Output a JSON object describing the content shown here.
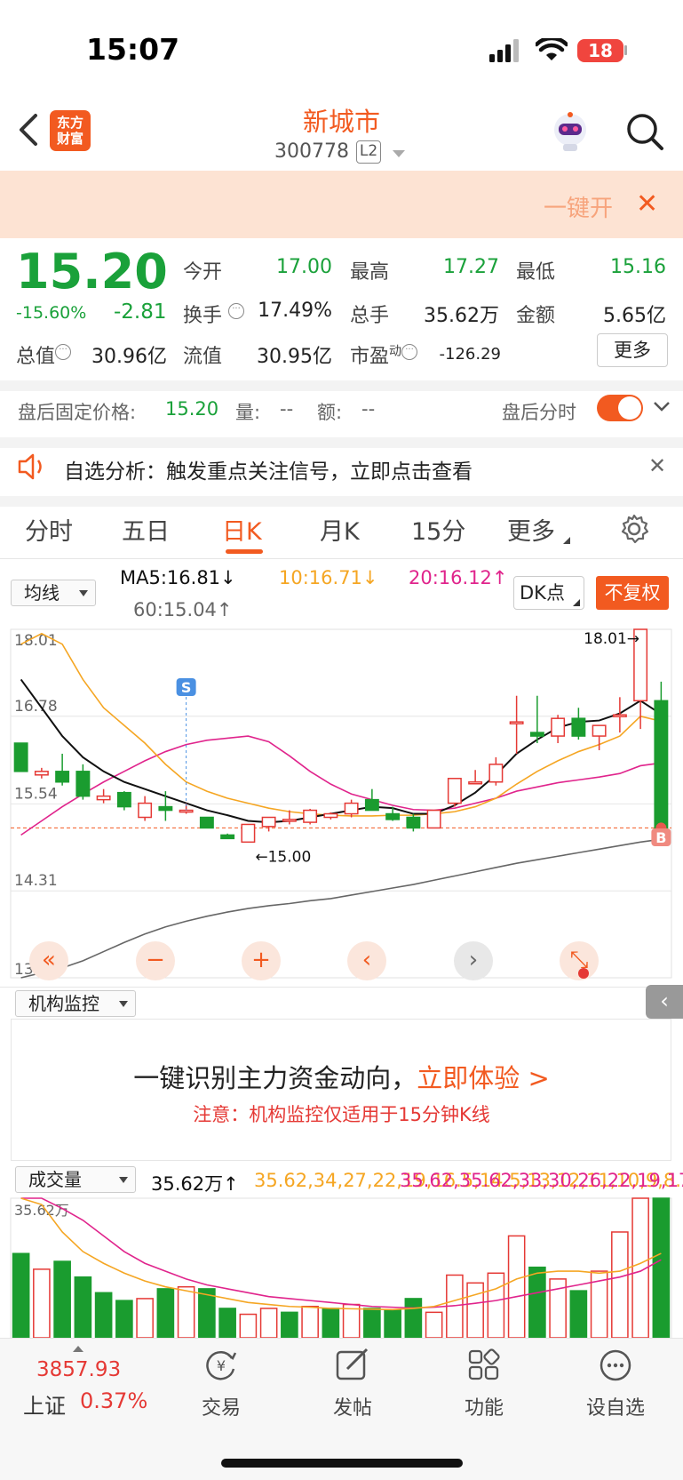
{
  "status_bar": {
    "time": "15:07",
    "battery": "18"
  },
  "header": {
    "logo_line1": "东方",
    "logo_line2": "财富",
    "name": "新城市",
    "code": "300778",
    "level": "L2"
  },
  "banner": {
    "text": "一键开",
    "close": "✕"
  },
  "quote": {
    "price": "15.20",
    "pct": "-15.60%",
    "change": "-2.81",
    "fields": {
      "open_label": "今开",
      "open": "17.00",
      "high_label": "最高",
      "high": "17.27",
      "low_label": "最低",
      "low": "15.16",
      "turnover_label": "换手",
      "turnover": "17.49%",
      "total_hands_label": "总手",
      "total_hands": "35.62万",
      "amount_label": "金额",
      "amount": "5.65亿",
      "mcap_label": "总值",
      "mcap": "30.96亿",
      "float_label": "流值",
      "float": "30.95亿",
      "pe_label": "市盈",
      "pe_sup": "动",
      "pe": "-126.29"
    },
    "more": "更多"
  },
  "after_hours": {
    "label": "盘后固定价格:",
    "price": "15.20",
    "vol_label": "量:",
    "vol": "--",
    "amt_label": "额:",
    "amt": "--",
    "toggle_label": "盘后分时"
  },
  "alert": {
    "text": "自选分析：触发重点关注信号，立即点击查看",
    "close": "✕"
  },
  "tabs": [
    "分时",
    "五日",
    "日K",
    "月K",
    "15分",
    "更多"
  ],
  "active_tab": "日K",
  "ma_bar": {
    "selector": "均线",
    "ma5": "MA5:16.81↓",
    "ma10": "10:16.71↓",
    "ma20": "20:16.12↑",
    "ma60": "60:15.04↑",
    "dk": "DK点",
    "fq": "不复权"
  },
  "colors": {
    "up": "#e53935",
    "down": "#1a9c2f",
    "accent": "#f25a20",
    "ma5": "#111111",
    "ma10": "#f5a623",
    "ma20": "#e0248c",
    "ma60": "#666666"
  },
  "chart_data": {
    "type": "candlestick",
    "y_ticks": [
      "18.01",
      "16.78",
      "15.54",
      "14.31",
      "13.08"
    ],
    "ylim": [
      13.08,
      18.01
    ],
    "markers": {
      "high_label": "18.01",
      "low_label": "15.00",
      "sell": "S",
      "buy": "B"
    },
    "candles": [
      [
        16.4,
        16.4,
        16.0,
        16.0
      ],
      [
        15.95,
        16.05,
        15.9,
        16.0
      ],
      [
        16.0,
        16.25,
        15.8,
        15.85
      ],
      [
        16.0,
        16.1,
        15.6,
        15.65
      ],
      [
        15.6,
        15.75,
        15.55,
        15.65
      ],
      [
        15.7,
        15.72,
        15.45,
        15.5
      ],
      [
        15.35,
        15.65,
        15.3,
        15.55
      ],
      [
        15.5,
        15.72,
        15.3,
        15.45
      ],
      [
        15.45,
        15.55,
        15.4,
        15.45
      ],
      [
        15.35,
        15.35,
        15.2,
        15.2
      ],
      [
        15.1,
        15.12,
        15.05,
        15.05
      ],
      [
        15.0,
        15.25,
        15.0,
        15.25
      ],
      [
        15.22,
        15.35,
        15.15,
        15.35
      ],
      [
        15.3,
        15.45,
        15.25,
        15.32
      ],
      [
        15.28,
        15.47,
        15.25,
        15.45
      ],
      [
        15.35,
        15.42,
        15.32,
        15.4
      ],
      [
        15.4,
        15.6,
        15.35,
        15.55
      ],
      [
        15.6,
        15.75,
        15.45,
        15.45
      ],
      [
        15.4,
        15.5,
        15.3,
        15.32
      ],
      [
        15.35,
        15.4,
        15.15,
        15.2
      ],
      [
        15.2,
        15.45,
        15.2,
        15.45
      ],
      [
        15.55,
        15.9,
        15.5,
        15.9
      ],
      [
        15.85,
        16.02,
        15.83,
        15.85
      ],
      [
        15.85,
        16.2,
        15.8,
        16.1
      ],
      [
        16.7,
        17.07,
        16.25,
        16.7
      ],
      [
        16.55,
        17.07,
        16.4,
        16.5
      ],
      [
        16.5,
        16.8,
        16.4,
        16.75
      ],
      [
        16.75,
        16.9,
        16.45,
        16.5
      ],
      [
        16.5,
        16.6,
        16.3,
        16.65
      ],
      [
        16.8,
        17.05,
        16.55,
        16.8
      ],
      [
        17.0,
        18.01,
        16.6,
        18.01
      ],
      [
        17.0,
        17.27,
        15.16,
        15.2
      ]
    ],
    "ma5": [
      17.3,
      16.9,
      16.5,
      16.2,
      16.0,
      15.85,
      15.75,
      15.65,
      15.55,
      15.45,
      15.38,
      15.3,
      15.28,
      15.3,
      15.35,
      15.4,
      15.45,
      15.5,
      15.48,
      15.4,
      15.4,
      15.52,
      15.7,
      15.95,
      16.25,
      16.45,
      16.62,
      16.7,
      16.72,
      16.82,
      17.0,
      16.81
    ],
    "ma10": [
      17.8,
      17.95,
      17.8,
      17.3,
      16.9,
      16.65,
      16.4,
      16.1,
      15.85,
      15.72,
      15.62,
      15.55,
      15.48,
      15.43,
      15.4,
      15.38,
      15.37,
      15.37,
      15.38,
      15.38,
      15.4,
      15.43,
      15.5,
      15.62,
      15.82,
      16.0,
      16.15,
      16.28,
      16.38,
      16.5,
      16.78,
      16.71
    ],
    "ma20": [
      15.1,
      15.3,
      15.5,
      15.68,
      15.85,
      16.0,
      16.15,
      16.28,
      16.38,
      16.44,
      16.47,
      16.5,
      16.42,
      16.22,
      16.0,
      15.82,
      15.68,
      15.6,
      15.52,
      15.46,
      15.45,
      15.48,
      15.55,
      15.62,
      15.72,
      15.78,
      15.84,
      15.88,
      15.92,
      15.97,
      16.08,
      16.12
    ],
    "ma60": [
      13.08,
      13.15,
      13.22,
      13.32,
      13.45,
      13.58,
      13.7,
      13.8,
      13.88,
      13.95,
      14.01,
      14.06,
      14.1,
      14.13,
      14.17,
      14.2,
      14.25,
      14.3,
      14.35,
      14.4,
      14.46,
      14.52,
      14.58,
      14.64,
      14.7,
      14.75,
      14.8,
      14.85,
      14.9,
      14.95,
      15.0,
      15.04
    ]
  },
  "chart_nav": [
    "«",
    "−",
    "+",
    "‹",
    "›",
    "⤡"
  ],
  "institution": {
    "selector": "机构监控",
    "headline": "一键识别主力资金动向，",
    "cta": "立即体验 >",
    "note": "注意：机构监控仅适用于15分钟K线",
    "side": "‹"
  },
  "volume": {
    "selector": "成交量",
    "vol": "35.62万↑",
    "ma1": [
      35.62,
      34.0,
      27.0,
      22.0,
      19.0,
      16.5,
      14.5,
      13.0,
      12.0,
      11.0,
      10.0,
      9.0,
      8.5,
      8.0,
      7.8,
      7.5,
      7.4,
      7.3,
      7.2,
      7.5,
      8.0,
      9.5,
      11.0,
      12.5,
      15.0,
      16.5,
      17.0,
      17.0,
      16.5,
      17.0,
      19.0,
      21.54
    ],
    "ma2": [
      35.62,
      35.62,
      33.0,
      30.0,
      26.0,
      22.0,
      19.0,
      17.0,
      15.0,
      13.5,
      12.5,
      11.5,
      10.5,
      10.0,
      9.5,
      9.0,
      8.5,
      8.0,
      7.8,
      7.6,
      7.8,
      8.2,
      8.8,
      9.5,
      10.5,
      11.5,
      12.5,
      13.5,
      14.5,
      15.5,
      17.0,
      19.93
    ],
    "top_label": "35.62万",
    "bars": [
      21.5,
      17.5,
      19.5,
      15.5,
      11.5,
      9.5,
      10.0,
      12.5,
      13.0,
      12.5,
      7.5,
      6.0,
      7.5,
      6.5,
      8.0,
      7.5,
      8.5,
      7.5,
      7.0,
      10.0,
      6.5,
      16.0,
      14.0,
      16.5,
      26.0,
      18.0,
      15.0,
      12.0,
      17.0,
      27.0,
      35.62,
      35.62
    ],
    "bar_up": [
      false,
      true,
      false,
      false,
      false,
      false,
      true,
      false,
      true,
      false,
      false,
      true,
      true,
      false,
      true,
      false,
      true,
      false,
      false,
      false,
      true,
      true,
      true,
      true,
      true,
      false,
      true,
      false,
      true,
      true,
      true,
      false
    ]
  },
  "bottom_bar": {
    "index_value": "3857.93",
    "index_name": "上证",
    "index_pct": "0.37%",
    "items": [
      {
        "label": "交易",
        "icon": "yen-cycle-icon"
      },
      {
        "label": "发帖",
        "icon": "edit-icon"
      },
      {
        "label": "功能",
        "icon": "grid-icon"
      },
      {
        "label": "设自选",
        "icon": "more-dots-icon"
      }
    ]
  }
}
